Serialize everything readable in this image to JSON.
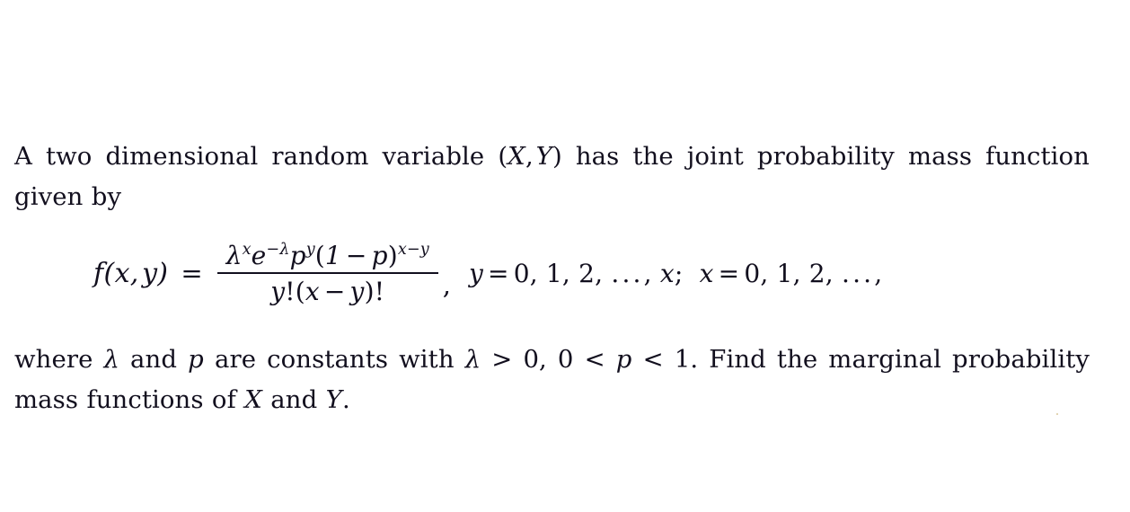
{
  "document": {
    "background_color": "#ffffff",
    "text_color": "#120f1e",
    "paragraph_1": {
      "line_1": "A two dimensional random variable (X, Y) has the joint probability mass",
      "line_2": "function given by",
      "full_text": "A two dimensional random variable (X, Y) has the joint probability mass function given by",
      "inline_math": [
        "(X, Y)"
      ]
    },
    "equation": {
      "lhs": "f(x, y)",
      "equals": "=",
      "numerator_plain": "λ^x e^{-λ} p^y (1 - p)^{x-y}",
      "denominator_plain": "y!(x - y)!",
      "numerator": {
        "lambda": "λ",
        "lambda_exponent": "x",
        "e": "e",
        "e_exponent": "−λ",
        "p": "p",
        "p_exponent": "y",
        "open_paren": "(",
        "one": "1",
        "minus": "−",
        "p2": "p",
        "close_paren": ")",
        "paren_exponent": "x−y"
      },
      "denominator": {
        "y": "y",
        "fact1": "!",
        "open_paren": "(",
        "x": "x",
        "minus": "−",
        "y2": "y",
        "close_paren": ")",
        "fact2": "!"
      },
      "trailing_comma": ",",
      "condition_y": "y = 0, 1, 2, … , x;",
      "condition_x": "x = 0, 1, 2, … ,",
      "conditions_full": "y = 0, 1, 2, … , x;  x = 0, 1, 2, … ,"
    },
    "paragraph_2": {
      "line_1": "where λ and p are constants with λ > 0, 0 < p < 1. Find the marginal",
      "line_2": "probability mass functions of X and Y.",
      "full_text": "where λ and p are constants with λ > 0, 0 < p < 1. Find the marginal probability mass functions of X and Y.",
      "constraints": [
        "λ > 0",
        "0 < p < 1"
      ],
      "question": "Find the marginal probability mass functions of X and Y."
    }
  }
}
